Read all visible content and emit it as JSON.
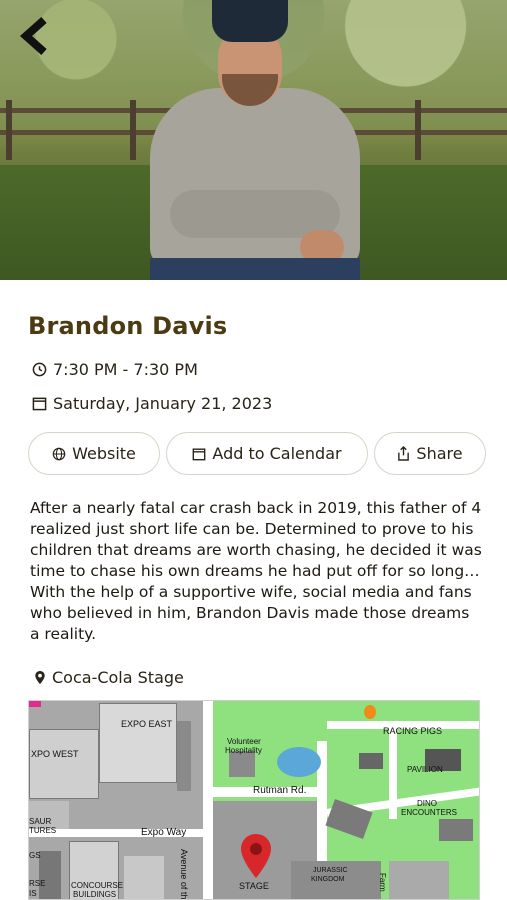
{
  "event": {
    "performer": "Brandon Davis",
    "time": "7:30 PM - 7:30 PM",
    "date": "Saturday, January 21, 2023",
    "description": "After a nearly fatal car crash back in 2019, this father of 4 realized just short life can be. Determined to prove to his children that dreams are worth chasing, he decided it was time to chase his own dreams he had put off for so long… With the help of a supportive wife, social media and fans who believed in him, Brandon Davis made those dreams a reality.",
    "location": "Coca-Cola Stage"
  },
  "actions": {
    "website": "Website",
    "add_to_calendar": "Add to Calendar",
    "share": "Share"
  },
  "map": {
    "labels": {
      "expo_east": "EXPO EAST",
      "expo_west": "XPO WEST",
      "expo_way": "Expo Way",
      "avenue": "Avenue of th",
      "volunteer": "Volunteer",
      "hospitality": "Hospitality",
      "rutman": "Rutman Rd.",
      "racing_pigs": "RACING PIGS",
      "pavilion": "PAVILION",
      "dino": "DINO",
      "encounters": "ENCOUNTERS",
      "stage": "STAGE",
      "jurassic": "JURASSIC",
      "kingdom": "KINGDOM",
      "concourse": "CONCOURSE",
      "buildings": "BUILDINGS",
      "saur": "SAUR",
      "tures": "TURES",
      "gs": "GS",
      "rse": "RSE",
      "is": "IS",
      "farm": "Farm"
    }
  },
  "colors": {
    "title": "#4c3a12",
    "map_green": "#8fe07f",
    "pin_red": "#d8272a"
  },
  "icons": [
    "back-chevron-icon",
    "clock-icon",
    "calendar-icon",
    "globe-icon",
    "share-icon",
    "map-pin-icon"
  ]
}
